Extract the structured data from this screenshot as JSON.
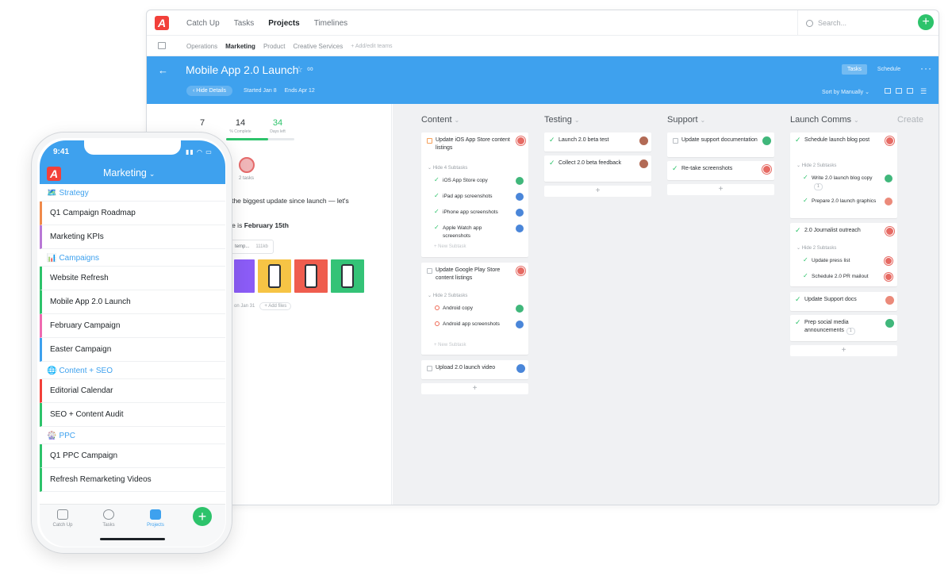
{
  "topbar": {
    "logo": "A",
    "nav": [
      "Catch Up",
      "Tasks",
      "Projects",
      "Timelines"
    ],
    "active_nav": "Projects",
    "search_placeholder": "Search...",
    "add": "+"
  },
  "teams": {
    "items": [
      "Operations",
      "Marketing",
      "Product",
      "Creative Services"
    ],
    "active": "Marketing",
    "add_label": "+ Add/edit teams"
  },
  "project": {
    "title": "Mobile App 2.0 Launch",
    "hide_details": "Hide Details",
    "started": "Started Jan 8",
    "ends": "Ends Apr 12",
    "view_tabs": [
      "Tasks",
      "Schedule"
    ],
    "active_view": "Tasks",
    "sort_label": "Sort by Manually"
  },
  "details": {
    "stats": [
      {
        "value": "7",
        "label": ""
      },
      {
        "value": "14",
        "label": "% Complete"
      },
      {
        "value": "34",
        "label": "Days left"
      }
    ],
    "progress": 0.62,
    "assignee_label": "2 tasks",
    "description": "e the biggest update since launch — let's",
    "launch_prefix": "ate is ",
    "launch_date": "February 15th",
    "file_name": "temp...",
    "file_size": "111kb",
    "meta": "on Jan 31",
    "add_files": "+ Add files"
  },
  "board": {
    "columns": [
      {
        "name": "Content",
        "tasks": [
          {
            "title": "Update iOS App Store content listings",
            "hide_label": "Hide 4 Subtasks",
            "subtasks": [
              "iOS App Store copy",
              "iPad app screenshots",
              "iPhone app screenshots",
              "Apple Watch app screenshots"
            ]
          },
          {
            "title": "Update Google Play Store content listings",
            "hide_label": "Hide 2 Subtasks",
            "subtasks": [
              "Android copy",
              "Android app screenshots"
            ]
          },
          {
            "title": "Upload 2.0 launch video"
          }
        ]
      },
      {
        "name": "Testing",
        "tasks": [
          {
            "title": "Launch 2.0 beta test"
          },
          {
            "title": "Collect 2.0 beta feedback"
          }
        ]
      },
      {
        "name": "Support",
        "tasks": [
          {
            "title": "Update support documentation"
          },
          {
            "title": "Re-take screenshots"
          }
        ]
      },
      {
        "name": "Launch Comms",
        "tasks": [
          {
            "title": "Schedule launch blog post",
            "hide_label": "Hide 2 Subtasks",
            "subtasks": [
              "Write 2.0 launch blog copy",
              "Prepare 2.0 launch graphics"
            ],
            "sub_count": "1"
          },
          {
            "title": "2.0 Journalist outreach",
            "hide_label": "Hide 2 Subtasks",
            "subtasks": [
              "Update press list",
              "Schedule 2.0 PR mailout"
            ]
          },
          {
            "title": "Update Support docs"
          },
          {
            "title": "Prep social media announcements",
            "count": "1"
          }
        ]
      }
    ],
    "new_subtask": "+ New Subtask",
    "add_symbol": "+",
    "create_label": "Create"
  },
  "phone": {
    "time": "9:41",
    "title": "Marketing",
    "groups": [
      {
        "icon": "🗺️",
        "name": "Strategy",
        "items": [
          {
            "name": "Q1 Campaign Roadmap",
            "color": "#f08a4b"
          },
          {
            "name": "Marketing KPIs",
            "color": "#b978d6"
          }
        ]
      },
      {
        "icon": "📊",
        "name": "Campaigns",
        "items": [
          {
            "name": "Website Refresh",
            "color": "#2dc36b"
          },
          {
            "name": "Mobile App 2.0 Launch",
            "color": "#2dc36b"
          },
          {
            "name": "February Campaign",
            "color": "#ef6ab0"
          },
          {
            "name": "Easter Campaign",
            "color": "#3ea1ee"
          }
        ]
      },
      {
        "icon": "🌐",
        "name": "Content + SEO",
        "items": [
          {
            "name": "Editorial Calendar",
            "color": "#f2403a"
          },
          {
            "name": "SEO + Content Audit",
            "color": "#2dc36b"
          }
        ]
      },
      {
        "icon": "🎡",
        "name": "PPC",
        "items": [
          {
            "name": "Q1 PPC Campaign",
            "color": "#2dc36b"
          },
          {
            "name": "Refresh Remarketing Videos",
            "color": "#2dc36b"
          }
        ]
      }
    ],
    "tabs": [
      "Catch Up",
      "Tasks",
      "Projects"
    ],
    "active_tab": "Projects"
  },
  "colors": {
    "accent": "#3ea1ee",
    "add_green": "#2dc36b",
    "logo_red": "#f2403a"
  }
}
